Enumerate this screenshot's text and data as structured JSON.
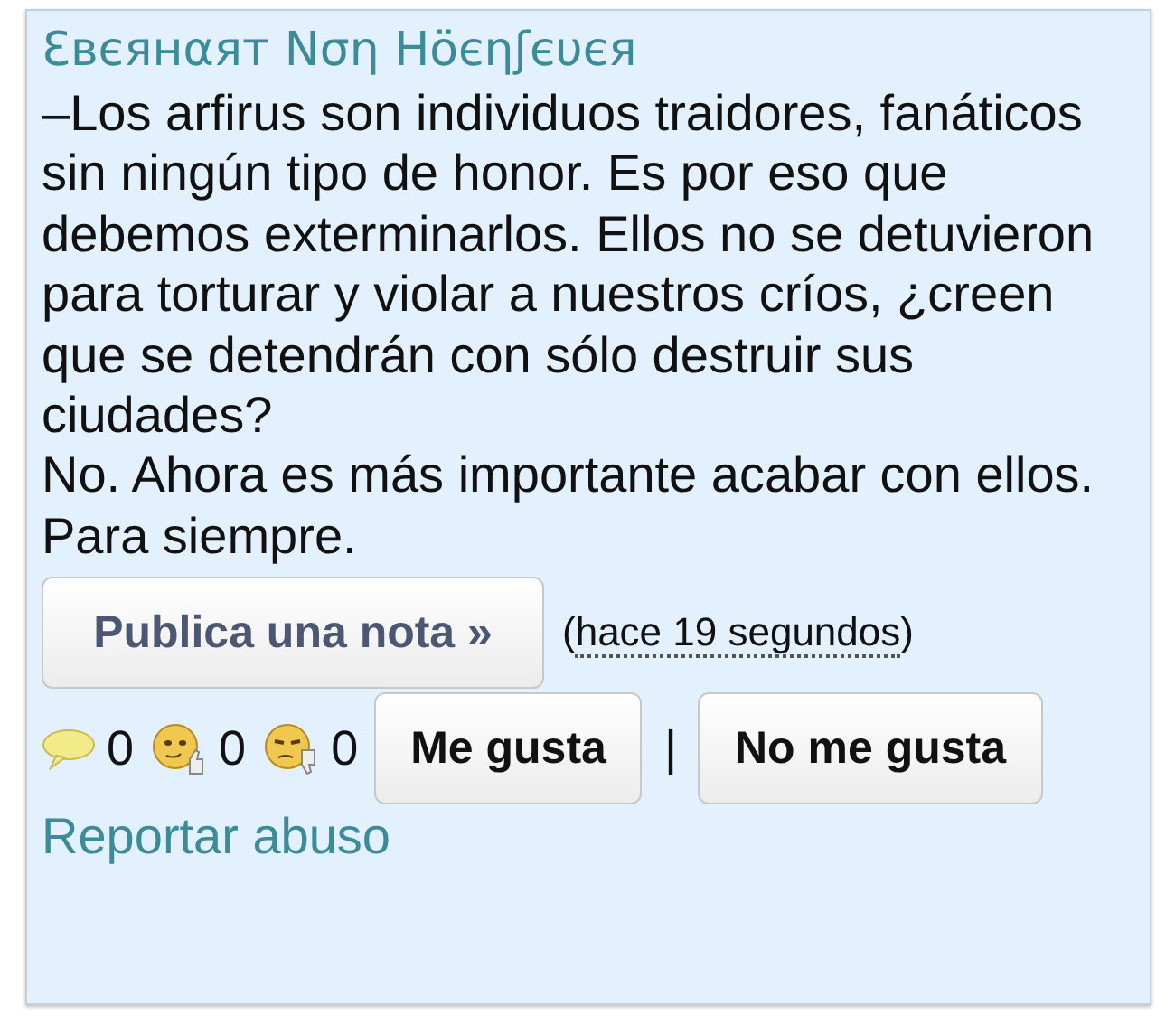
{
  "post": {
    "author": "Ɛвєянαят Nση Hӧєηʃєυєя",
    "paragraphs": [
      "–Los arfirus son individuos traidores, fanáticos sin ningún tipo de honor. Es por eso que debemos exterminarlos. Ellos no se detuvieron para torturar y violar a nuestros críos, ¿creen que se detendrán con sólo destruir sus ciudades?",
      "No. Ahora es más importante acabar con ellos. Para siempre."
    ],
    "note_button": "Publica una nota »",
    "timestamp": {
      "open": "(",
      "text": "hace 19 segundos",
      "close": ")"
    },
    "counters": [
      {
        "kind": "comments",
        "count": "0"
      },
      {
        "kind": "likes",
        "count": "0"
      },
      {
        "kind": "dislikes",
        "count": "0"
      }
    ],
    "like_button": "Me gusta",
    "separator": "|",
    "dislike_button": "No me gusta",
    "report_link": "Reportar abuso"
  }
}
